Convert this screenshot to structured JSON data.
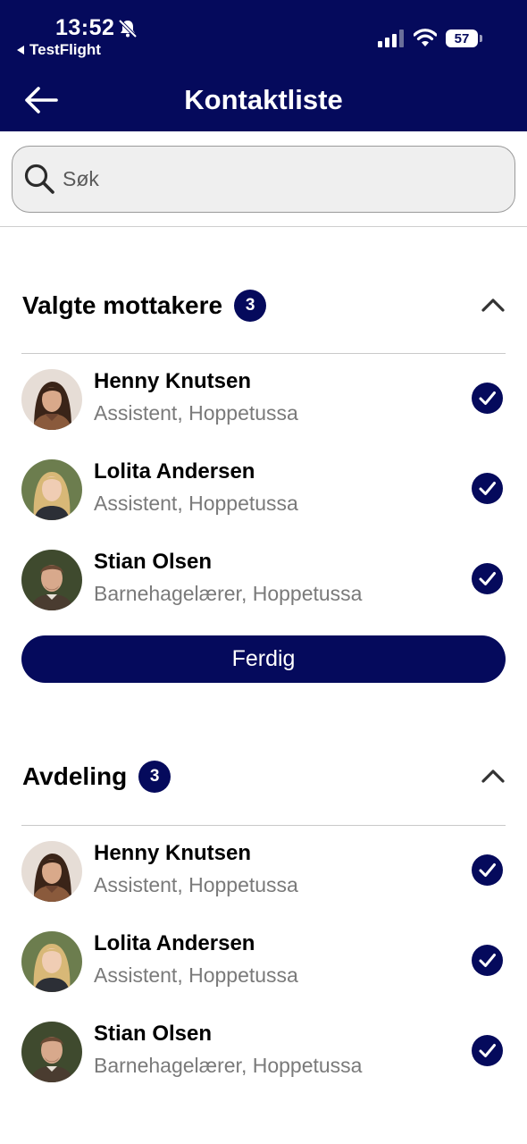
{
  "status_bar": {
    "time": "13:52",
    "back_app_label": "TestFlight",
    "battery": "57",
    "icons": [
      "bell-slash-icon",
      "signal-icon",
      "wifi-icon",
      "battery-icon"
    ]
  },
  "header": {
    "title": "Kontaktliste",
    "back_icon": "arrow-left-icon"
  },
  "search": {
    "placeholder": "Søk",
    "value": ""
  },
  "sections": [
    {
      "title": "Valgte mottakere",
      "count": "3",
      "expanded": true,
      "contacts": [
        {
          "name": "Henny Knutsen",
          "role": "Assistent, Hoppetussa",
          "selected": true
        },
        {
          "name": "Lolita Andersen",
          "role": "Assistent, Hoppetussa",
          "selected": true
        },
        {
          "name": "Stian Olsen",
          "role": "Barnehagelærer, Hoppetussa",
          "selected": true
        }
      ],
      "done_label": "Ferdig"
    },
    {
      "title": "Avdeling",
      "count": "3",
      "expanded": true,
      "contacts": [
        {
          "name": "Henny Knutsen",
          "role": "Assistent, Hoppetussa",
          "selected": true
        },
        {
          "name": "Lolita Andersen",
          "role": "Assistent, Hoppetussa",
          "selected": true
        },
        {
          "name": "Stian Olsen",
          "role": "Barnehagelærer, Hoppetussa",
          "selected": true
        }
      ]
    }
  ],
  "colors": {
    "brand": "#050a5c",
    "secondary_text": "#7a7a7a",
    "divider": "#c9c9c9",
    "search_bg": "#efefef"
  }
}
